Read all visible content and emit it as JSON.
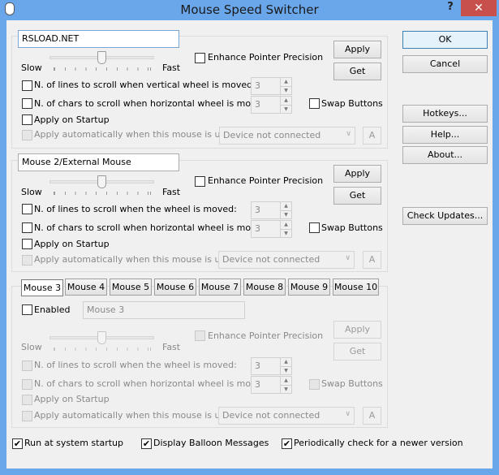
{
  "window": {
    "title": "Mouse Speed Switcher",
    "help_glyph": "?",
    "close_glyph": "✕",
    "title_color": "#6aa6ea",
    "close_color": "#c7504d"
  },
  "common": {
    "slow": "Slow",
    "fast": "Fast",
    "enhance": "Enhance Pointer Precision",
    "apply": "Apply",
    "get": "Get",
    "chars_scroll": "N. of chars to scroll when  horizontal wheel is moved:",
    "swap": "Swap Buttons",
    "startup": "Apply on Startup",
    "auto": "Apply automatically when this mouse is used:",
    "device": "Device not connected",
    "a": "A"
  },
  "mouse1": {
    "name": "RSLOAD.NET",
    "lines_scroll": "N. of lines to scroll when vertical wheel is moved:",
    "lines_value": "3",
    "chars_value": "3",
    "speed_fraction": 0.5
  },
  "mouse2": {
    "name": "Mouse 2/External Mouse",
    "lines_scroll": "N. of lines to scroll when the wheel is moved:",
    "lines_value": "3",
    "chars_value": "3",
    "speed_fraction": 0.5
  },
  "tabs": [
    "Mouse 3",
    "Mouse 4",
    "Mouse 5",
    "Mouse 6",
    "Mouse 7",
    "Mouse 8",
    "Mouse 9",
    "Mouse 10"
  ],
  "mouse3": {
    "enabled": "Enabled",
    "name": "Mouse 3",
    "lines_scroll": "N. of lines to scroll when the wheel is moved:",
    "lines_value": "3",
    "chars_value": "3",
    "speed_fraction": 0.5
  },
  "side": {
    "ok": "OK",
    "cancel": "Cancel",
    "hotkeys": "Hotkeys...",
    "help": "Help...",
    "about": "About...",
    "check_updates": "Check Updates..."
  },
  "bottom": {
    "run_startup": "Run at system startup",
    "balloon": "Display Balloon Messages",
    "check_newer": "Periodically check for a newer version",
    "checked": [
      true,
      true,
      true
    ]
  }
}
